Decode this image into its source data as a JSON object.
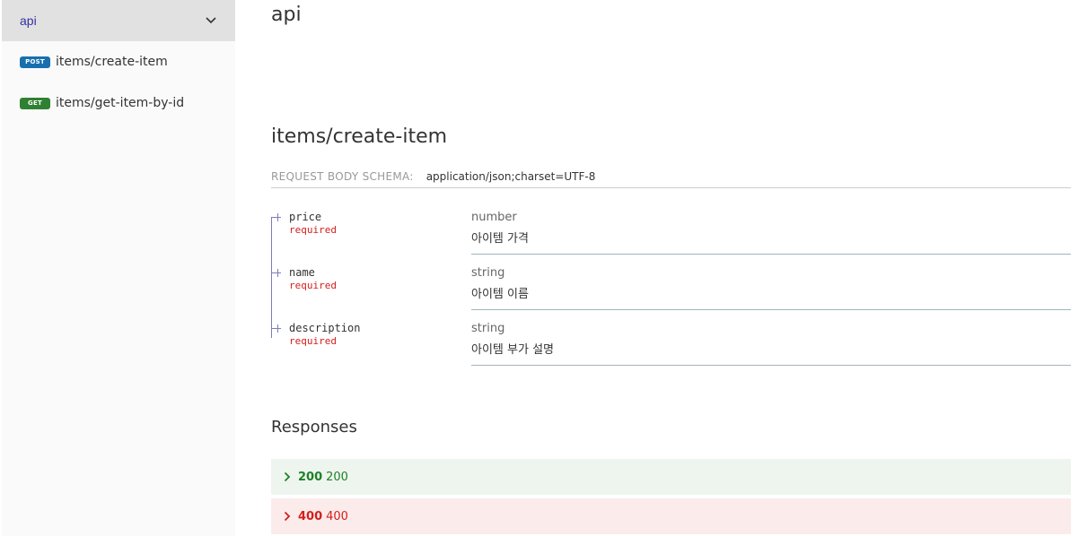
{
  "sidebar": {
    "group_label": "api",
    "items": [
      {
        "method": "POST",
        "label": "items/create-item"
      },
      {
        "method": "GET",
        "label": "items/get-item-by-id"
      }
    ]
  },
  "main": {
    "section_title": "api",
    "operation_title": "items/create-item",
    "request_body": {
      "label": "REQUEST BODY SCHEMA:",
      "content_type": "application/json;charset=UTF-8"
    },
    "properties": [
      {
        "name": "price",
        "required": "required",
        "type": "number",
        "description": "아이템 가격"
      },
      {
        "name": "name",
        "required": "required",
        "type": "string",
        "description": "아이템 이름"
      },
      {
        "name": "description",
        "required": "required",
        "type": "string",
        "description": "아이템 부가 설명"
      }
    ],
    "responses_title": "Responses",
    "responses": [
      {
        "code": "200",
        "text": "200"
      },
      {
        "code": "400",
        "text": "400"
      }
    ]
  },
  "colors": {
    "post_badge": "#186faf",
    "get_badge": "#2f8132",
    "success": "#1d8127",
    "error": "#d41f1c",
    "active_group": "#32329f"
  },
  "icons": [
    "chevron-down-icon",
    "chevron-right-icon"
  ]
}
